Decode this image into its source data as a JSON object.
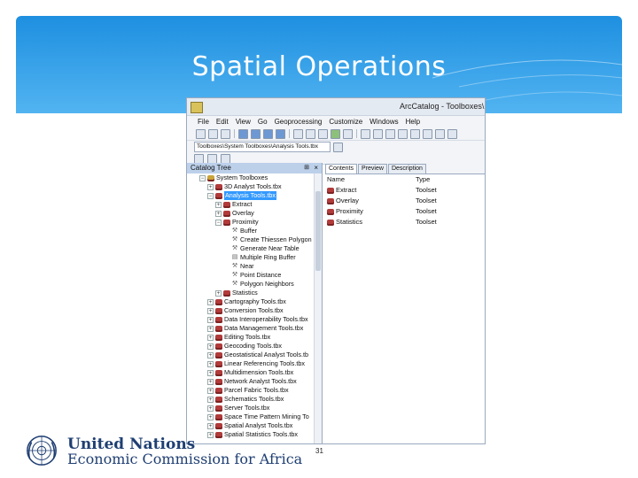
{
  "slide": {
    "title": "Spatial Operations",
    "page_number": "31"
  },
  "colors": {
    "header_top": "#1e8fe0",
    "header_bottom": "#52b4f1",
    "selection": "#3399ff",
    "toolbox_icon": "#b13b3b",
    "un_blue": "#1f3f73"
  },
  "window": {
    "title": "ArcCatalog - Toolboxes\\",
    "menu": [
      "File",
      "Edit",
      "View",
      "Go",
      "Geoprocessing",
      "Customize",
      "Windows",
      "Help"
    ],
    "address": "Toolboxes\\System Toolboxes\\Analysis Tools.tbx"
  },
  "catalog_tree": {
    "title": "Catalog Tree",
    "pin_icon": "pin-icon",
    "close_icon": "close-icon",
    "items": [
      {
        "label": "System Toolboxes",
        "toggle": "−",
        "icon": "folder-icon"
      },
      {
        "label": "3D Analyst Tools.tbx",
        "toggle": "+",
        "icon": "toolbox-icon"
      },
      {
        "label": "Analysis Tools.tbx",
        "toggle": "−",
        "icon": "toolbox-icon",
        "selected": true
      },
      {
        "label": "Extract",
        "toggle": "+",
        "icon": "toolset-icon"
      },
      {
        "label": "Overlay",
        "toggle": "+",
        "icon": "toolset-icon"
      },
      {
        "label": "Proximity",
        "toggle": "−",
        "icon": "toolset-icon"
      },
      {
        "label": "Buffer",
        "toggle": "",
        "icon": "hammer-icon"
      },
      {
        "label": "Create Thiessen Polygon",
        "toggle": "",
        "icon": "hammer-icon"
      },
      {
        "label": "Generate Near Table",
        "toggle": "",
        "icon": "hammer-icon"
      },
      {
        "label": "Multiple Ring Buffer",
        "toggle": "",
        "icon": "script-icon"
      },
      {
        "label": "Near",
        "toggle": "",
        "icon": "hammer-icon"
      },
      {
        "label": "Point Distance",
        "toggle": "",
        "icon": "hammer-icon"
      },
      {
        "label": "Polygon Neighbors",
        "toggle": "",
        "icon": "hammer-icon"
      },
      {
        "label": "Statistics",
        "toggle": "+",
        "icon": "toolset-icon"
      },
      {
        "label": "Cartography Tools.tbx",
        "toggle": "+",
        "icon": "toolbox-icon"
      },
      {
        "label": "Conversion Tools.tbx",
        "toggle": "+",
        "icon": "toolbox-icon"
      },
      {
        "label": "Data Interoperability Tools.tbx",
        "toggle": "+",
        "icon": "toolbox-icon"
      },
      {
        "label": "Data Management Tools.tbx",
        "toggle": "+",
        "icon": "toolbox-icon"
      },
      {
        "label": "Editing Tools.tbx",
        "toggle": "+",
        "icon": "toolbox-icon"
      },
      {
        "label": "Geocoding Tools.tbx",
        "toggle": "+",
        "icon": "toolbox-icon"
      },
      {
        "label": "Geostatistical Analyst Tools.tb",
        "toggle": "+",
        "icon": "toolbox-icon"
      },
      {
        "label": "Linear Referencing Tools.tbx",
        "toggle": "+",
        "icon": "toolbox-icon"
      },
      {
        "label": "Multidimension Tools.tbx",
        "toggle": "+",
        "icon": "toolbox-icon"
      },
      {
        "label": "Network Analyst Tools.tbx",
        "toggle": "+",
        "icon": "toolbox-icon"
      },
      {
        "label": "Parcel Fabric Tools.tbx",
        "toggle": "+",
        "icon": "toolbox-icon"
      },
      {
        "label": "Schematics Tools.tbx",
        "toggle": "+",
        "icon": "toolbox-icon"
      },
      {
        "label": "Server Tools.tbx",
        "toggle": "+",
        "icon": "toolbox-icon"
      },
      {
        "label": "Space Time Pattern Mining To",
        "toggle": "+",
        "icon": "toolbox-icon"
      },
      {
        "label": "Spatial Analyst Tools.tbx",
        "toggle": "+",
        "icon": "toolbox-icon"
      },
      {
        "label": "Spatial Statistics Tools.tbx",
        "toggle": "+",
        "icon": "toolbox-icon"
      }
    ]
  },
  "contents": {
    "tabs": [
      "Contents",
      "Preview",
      "Description"
    ],
    "active_tab": "Contents",
    "columns": [
      "Name",
      "Type"
    ],
    "rows": [
      {
        "name": "Extract",
        "type": "Toolset"
      },
      {
        "name": "Overlay",
        "type": "Toolset"
      },
      {
        "name": "Proximity",
        "type": "Toolset"
      },
      {
        "name": "Statistics",
        "type": "Toolset"
      }
    ]
  },
  "footer": {
    "org_name": "United Nations",
    "org_sub": "Economic Commission for Africa"
  }
}
